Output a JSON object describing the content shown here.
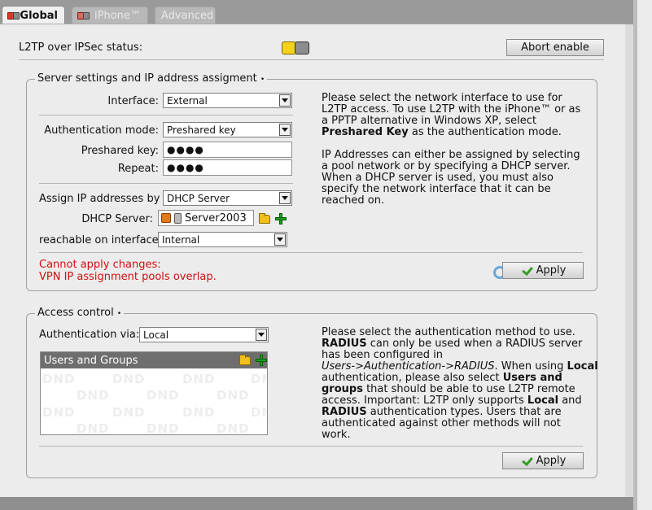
{
  "tabs": [
    {
      "label": "Global",
      "active": true
    },
    {
      "label": "iPhone™",
      "active": false
    },
    {
      "label": "Advanced",
      "active": false
    }
  ],
  "status": {
    "label": "L2TP over IPSec status:",
    "icon": "status-toggle-icon",
    "abort_button": "Abort enable"
  },
  "server_settings": {
    "legend": "Server settings and IP address assigment",
    "interface_label": "Interface:",
    "interface_value": "External",
    "auth_mode_label": "Authentication mode:",
    "auth_mode_value": "Preshared key",
    "preshared_label": "Preshared key:",
    "preshared_value": "●●●●",
    "repeat_label": "Repeat:",
    "repeat_value": "●●●●",
    "assign_ip_label": "Assign IP addresses by",
    "assign_ip_value": "DHCP Server",
    "dhcp_label": "DHCP Server:",
    "dhcp_value": "Server2003",
    "reachable_label": "reachable on interface",
    "reachable_value": "Internal",
    "error_line1": "Cannot apply changes:",
    "error_line2": "VPN IP assignment pools overlap.",
    "apply": "Apply",
    "help1": {
      "l1": "Please select the network interface to use for",
      "l2": "L2TP access. To use L2TP with the iPhone™ or as",
      "l3": "a PPTP alternative in Windows XP, select",
      "l4_bold": "Preshared Key",
      "l4_rest": " as the authentication mode."
    },
    "help2": [
      "IP Addresses can either be assigned by selecting",
      "a pool network or by specifying a DHCP server.",
      "When a DHCP server is used, you must also",
      "specify the network interface that it can be",
      "reached on."
    ]
  },
  "access_control": {
    "legend": "Access control",
    "auth_via_label": "Authentication via:",
    "auth_via_value": "Local",
    "users_groups_title": "Users and Groups",
    "dnd": "DND",
    "apply": "Apply",
    "help": {
      "l1": "Please select the authentication method to use.",
      "l2_bold": "RADIUS",
      "l2_rest": " can only be used when a RADIUS server",
      "l3": "has been configured in",
      "l4_italic": "Users->Authentication->RADIUS",
      "l4_rest": ". When using ",
      "l4_bold": "Local",
      "l5_rest": "authentication, please also select ",
      "l5_bold": "Users and",
      "l6_bold": "groups",
      "l6_rest": " that should be able to use L2TP remote",
      "l7_rest": "access. Important: L2TP only supports ",
      "l7_bold": "Local",
      "l7_end": " and",
      "l8_bold": "RADIUS",
      "l8_rest": " authentication types. Users that are",
      "l9": "authenticated against other methods will not",
      "l10": "work."
    }
  },
  "colors": {
    "error": "#d01010",
    "panel": "#ececec",
    "accent_green": "#1fa01f"
  }
}
